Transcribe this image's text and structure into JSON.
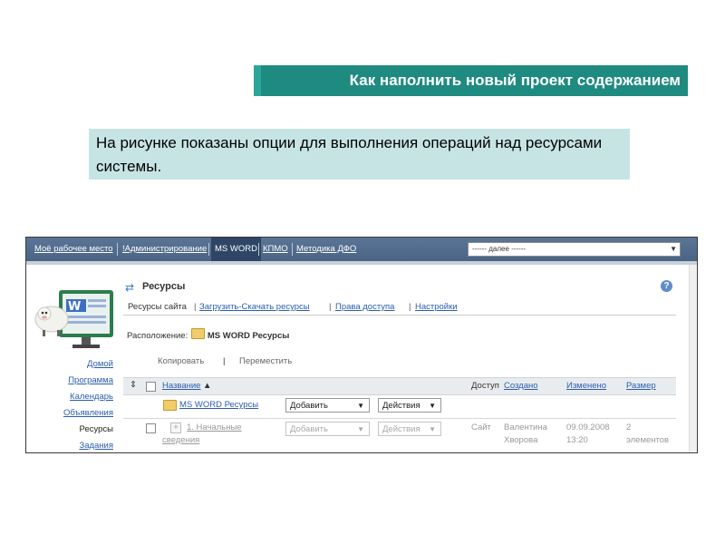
{
  "slide": {
    "title": "Как наполнить новый проект содержанием",
    "description": "На рисунке показаны опции для выполнения операций над ресурсами системы."
  },
  "topnav": {
    "items": [
      {
        "label": "Моё рабочее место"
      },
      {
        "label": "!Администрирование"
      },
      {
        "label": "MS WORD"
      },
      {
        "label": "КПМО"
      },
      {
        "label": "Методика ДФО"
      }
    ],
    "site_select": "------ далее ------"
  },
  "sidebar": {
    "links": [
      "Домой",
      "Программа",
      "Календарь",
      "Объявления",
      "Ресурсы",
      "Задания"
    ]
  },
  "resources": {
    "title": "Ресурсы",
    "tabs": [
      "Ресурсы сайта",
      "Загрузить-Скачать ресурсы",
      "Права доступа",
      "Настройки"
    ],
    "location_label": "Расположение:",
    "location_value": "MS WORD Ресурсы",
    "actions": [
      "Копировать",
      "Переместить"
    ],
    "columns": {
      "name": "Название",
      "access": "Доступ",
      "created": "Создано",
      "modified": "Изменено",
      "size": "Размер"
    },
    "rows": [
      {
        "name": "MS WORD Ресурсы",
        "add": "Добавить",
        "actions": "Действия"
      },
      {
        "name_line1": "1. Начальные",
        "name_line2": "сведения",
        "add": "Добавить",
        "actions": "Действия",
        "access": "Сайт",
        "author_line1": "Валентина",
        "author_line2": "Хворова",
        "date_line1": "09.09.2008",
        "date_line2": "13:20",
        "size_line1": "2",
        "size_line2": "элементов"
      }
    ]
  },
  "colors": {
    "title_bg": "#1f8a80",
    "desc_bg": "#c7e4e4",
    "nav_bg": "#4a6486"
  }
}
